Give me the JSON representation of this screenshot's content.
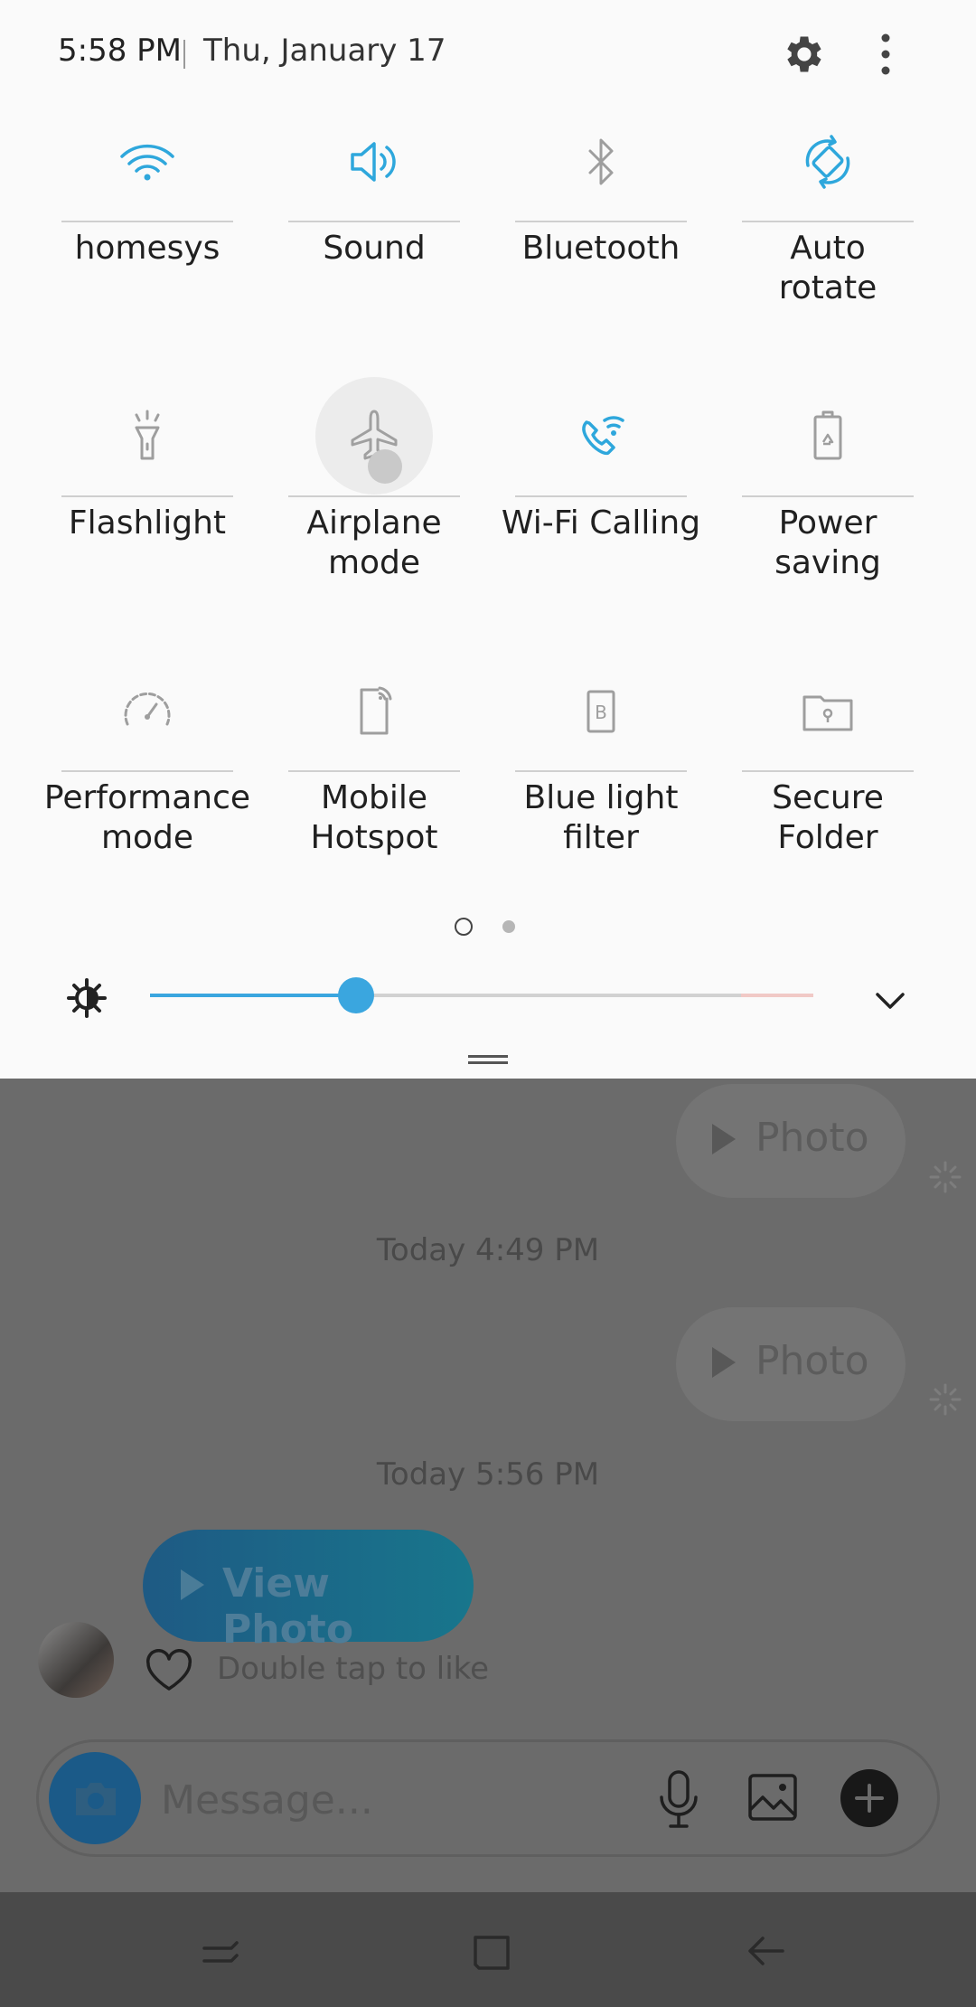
{
  "status_bar": {
    "time": "5:58 PM",
    "date": "Thu, January 17",
    "settings_icon": "gear-icon",
    "more_icon": "more-vertical-icon"
  },
  "quick_settings": {
    "tiles": [
      {
        "label": "homesys",
        "icon": "wifi-icon",
        "active": true
      },
      {
        "label": "Sound",
        "icon": "speaker-icon",
        "active": true
      },
      {
        "label": "Bluetooth",
        "icon": "bluetooth-icon",
        "active": false
      },
      {
        "label": "Auto\nrotate",
        "icon": "auto-rotate-icon",
        "active": true
      },
      {
        "label": "Flashlight",
        "icon": "flashlight-icon",
        "active": false
      },
      {
        "label": "Airplane\nmode",
        "icon": "airplane-icon",
        "active": false
      },
      {
        "label": "Wi-Fi Calling",
        "icon": "wifi-calling-icon",
        "active": true
      },
      {
        "label": "Power\nsaving",
        "icon": "battery-saver-icon",
        "active": false
      },
      {
        "label": "Performance\nmode",
        "icon": "speedometer-icon",
        "active": false
      },
      {
        "label": "Mobile\nHotspot",
        "icon": "hotspot-icon",
        "active": false
      },
      {
        "label": "Blue light\nfilter",
        "icon": "blue-light-icon",
        "active": false
      },
      {
        "label": "Secure\nFolder",
        "icon": "secure-folder-icon",
        "active": false
      }
    ],
    "page_count": 2,
    "current_page": 1,
    "brightness": 0.31,
    "accent_color": "#3aa6df"
  },
  "chat": {
    "messages": [
      {
        "type": "outgoing",
        "text": "Photo"
      },
      {
        "type": "timestamp",
        "text": "Today 4:49 PM"
      },
      {
        "type": "outgoing",
        "text": "Photo"
      },
      {
        "type": "timestamp",
        "text": "Today 5:56 PM"
      },
      {
        "type": "incoming",
        "text": "View Photo"
      }
    ],
    "like_hint": "Double tap to like",
    "composer_placeholder": "Message..."
  },
  "navigation": {
    "recents_icon": "recents-icon",
    "home_icon": "home-icon",
    "back_icon": "back-icon"
  }
}
